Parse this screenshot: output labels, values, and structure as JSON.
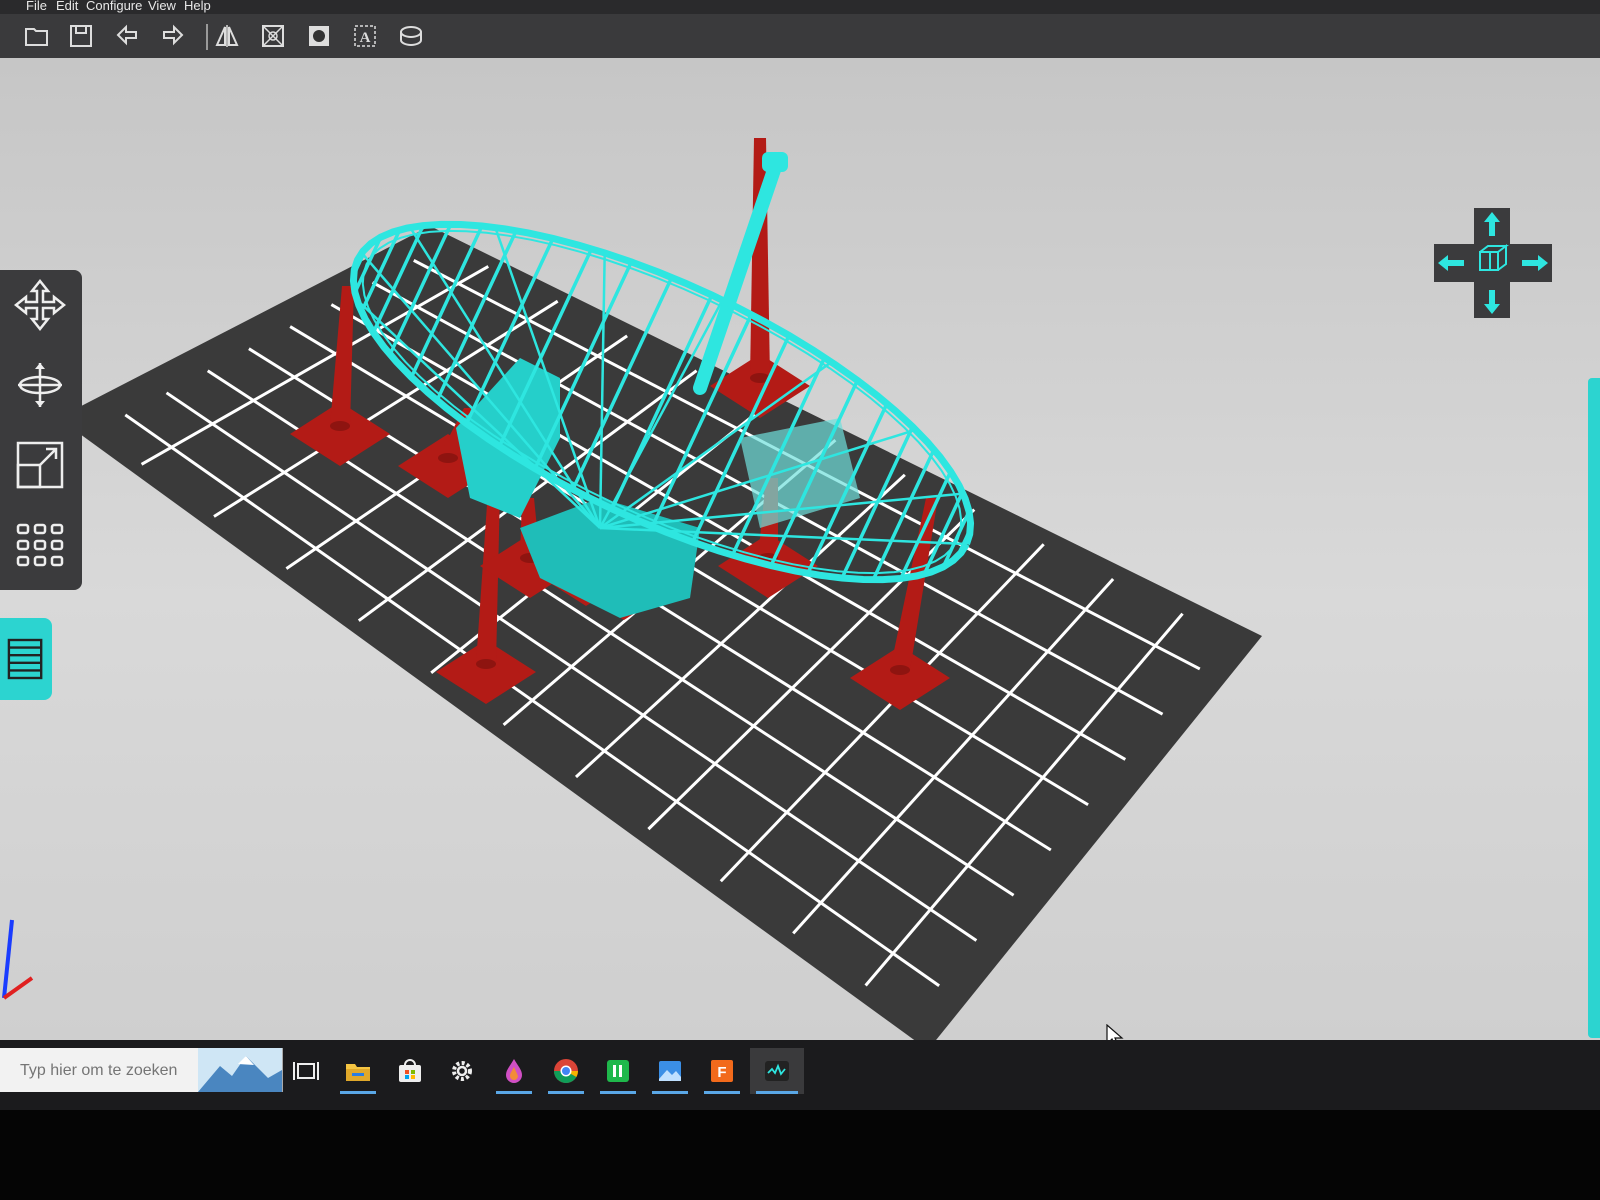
{
  "menu": {
    "items": [
      "File",
      "Edit",
      "Configure",
      "View",
      "Help"
    ]
  },
  "toolbar": {
    "tools": [
      {
        "name": "open-file",
        "icon": "folder-open-icon"
      },
      {
        "name": "save",
        "icon": "save-icon"
      },
      {
        "name": "undo",
        "icon": "undo-icon"
      },
      {
        "name": "redo",
        "icon": "redo-icon"
      },
      {
        "name": "mirror",
        "icon": "mirror-icon"
      },
      {
        "name": "hollow",
        "icon": "hollow-icon"
      },
      {
        "name": "drill",
        "icon": "drill-icon"
      },
      {
        "name": "text",
        "icon": "text-icon"
      },
      {
        "name": "drain",
        "icon": "drain-icon"
      }
    ]
  },
  "left_panel": {
    "tools": [
      {
        "name": "move",
        "icon": "move-icon"
      },
      {
        "name": "rotate",
        "icon": "rotate-icon"
      },
      {
        "name": "scale",
        "icon": "scale-icon"
      },
      {
        "name": "arrange",
        "icon": "grid-icon"
      },
      {
        "name": "layers",
        "icon": "layers-icon"
      }
    ]
  },
  "view_cube": {
    "arrows": [
      "up",
      "left",
      "right",
      "down"
    ]
  },
  "taskbar": {
    "search_placeholder": "Typ hier om te zoeken",
    "apps": [
      {
        "name": "task-view",
        "icon": "task-view-icon"
      },
      {
        "name": "file-explorer",
        "icon": "folder-icon"
      },
      {
        "name": "store",
        "icon": "store-icon"
      },
      {
        "name": "settings",
        "icon": "gear-icon"
      },
      {
        "name": "paint",
        "icon": "droplet-icon"
      },
      {
        "name": "chrome",
        "icon": "chrome-icon"
      },
      {
        "name": "sheets",
        "icon": "green-app-icon"
      },
      {
        "name": "photos",
        "icon": "photos-icon"
      },
      {
        "name": "fusion",
        "icon": "fusion-icon"
      },
      {
        "name": "slicer",
        "icon": "slicer-icon"
      }
    ]
  },
  "colors": {
    "model": "#2ee6e0",
    "supports": "#b31b16",
    "build_plate": "#3a3a3a",
    "grid_lines": "#ffffff",
    "accent": "#2cd4d0"
  }
}
